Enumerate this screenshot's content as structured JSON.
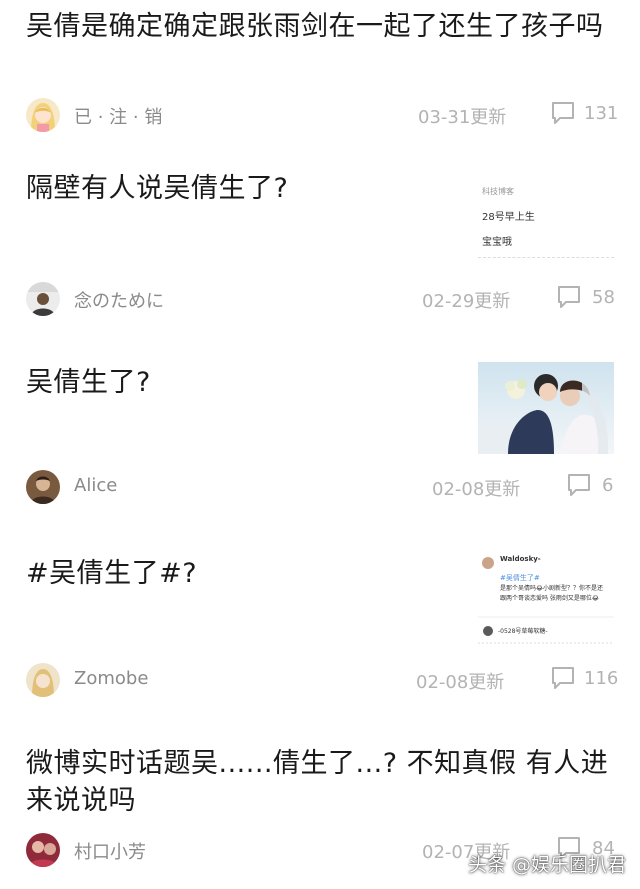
{
  "posts": [
    {
      "title": "吴倩是确定确定跟张雨剑在一起了还生了孩子吗",
      "author": "已 · 注 · 销",
      "date": "03-31更新",
      "comments": "131",
      "avatar_icon": "anime-girl-avatar-icon"
    },
    {
      "title": "隔壁有人说吴倩生了?",
      "author": "念のために",
      "date": "02-29更新",
      "comments": "58",
      "thumb": {
        "line1": "28号早上生",
        "line2": "宝宝哦",
        "top_text": "科技博客"
      }
    },
    {
      "title": "吴倩生了?",
      "author": "Alice",
      "date": "02-08更新",
      "comments": "6"
    },
    {
      "title": "#吴倩生了#?",
      "author": "Zomobe",
      "date": "02-08更新",
      "comments": "116",
      "thumb": {
        "user": "Waldosky-",
        "tag": "#吴倩生了#",
        "body1": "是那个吴倩吗😂小剧新型？？你不是还",
        "body2": "跟两个哥谈恋爱吗 张雨剑又是哪位😂",
        "reply": "-0528号草莓软糖-"
      }
    },
    {
      "title": "微博实时话题吴......倩生了...? 不知真假 有人进来说说吗",
      "author": "村口小芳",
      "date": "02-07更新",
      "comments": "84"
    }
  ],
  "watermark": "头条 @娱乐圈扒君",
  "colors": {
    "meta": "#b3b3b3",
    "author": "#8a8a8a",
    "divider": "#e6e6e6"
  }
}
